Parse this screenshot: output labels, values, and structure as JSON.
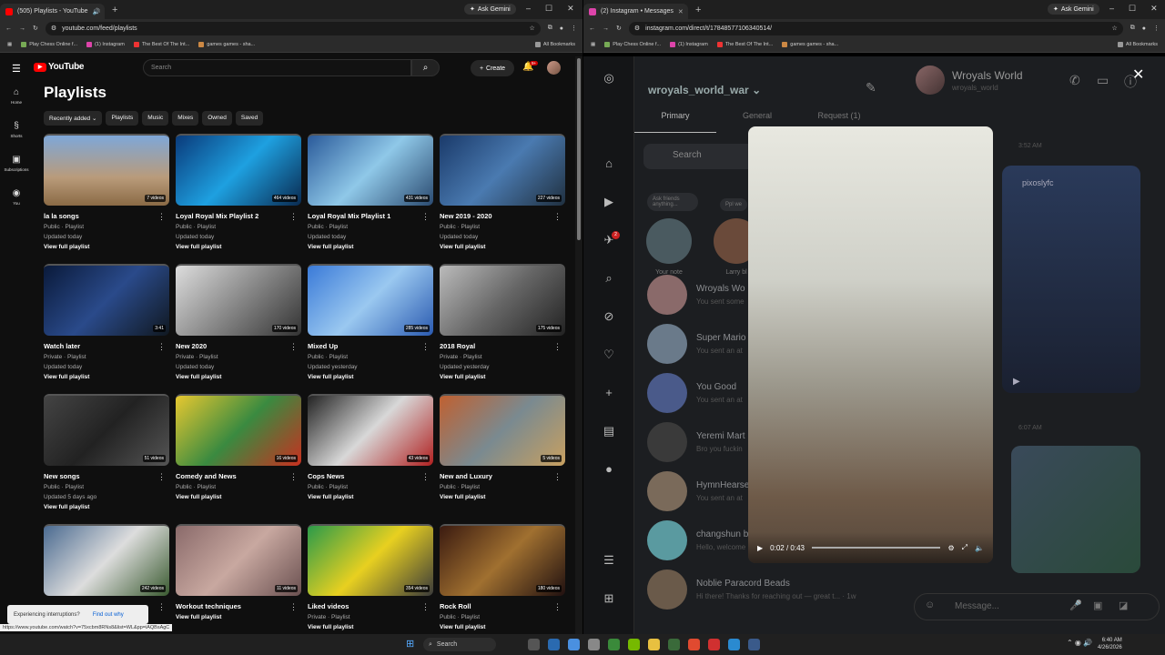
{
  "yt_window": {
    "tab_title": "(505) Playlists - YouTube",
    "ask_gemini": "Ask Gemini",
    "url": "youtube.com/feed/playlists",
    "bookmarks": [
      "Play Chess Online f...",
      "(1) Instagram",
      "The Best Of The Int...",
      "games games - sha..."
    ],
    "all_bookmarks": "All Bookmarks",
    "logo": "YouTube",
    "search_placeholder": "Search",
    "create": "Create",
    "notif_count": "9+",
    "side": [
      "Home",
      "Shorts",
      "Subscriptions",
      "You"
    ],
    "page_title": "Playlists",
    "chips": [
      "Recently added",
      "Playlists",
      "Music",
      "Mixes",
      "Owned",
      "Saved"
    ],
    "playlists": [
      {
        "name": "la la songs",
        "meta": [
          "Public · Playlist",
          "Updated today"
        ],
        "view": "View full playlist",
        "count": "7 videos",
        "bg": "linear-gradient(180deg,#7ea7d8 0%,#b99b7a 60%,#8a6a45 100%)"
      },
      {
        "name": "Loyal Royal Mix Playlist 2",
        "meta": [
          "Public · Playlist",
          "Updated today"
        ],
        "view": "View full playlist",
        "count": "464 videos",
        "bg": "linear-gradient(135deg,#0a3a7a,#1ea0e0,#0a2a50)"
      },
      {
        "name": "Loyal Royal Mix Playlist 1",
        "meta": [
          "Public · Playlist",
          "Updated today"
        ],
        "view": "View full playlist",
        "count": "431 videos",
        "bg": "linear-gradient(135deg,#2a5a9a,#8fc8e8,#2a4a70)"
      },
      {
        "name": "New 2019 - 2020",
        "meta": [
          "Public · Playlist",
          "Updated today"
        ],
        "view": "View full playlist",
        "count": "227 videos",
        "bg": "linear-gradient(135deg,#1a3a6a,#4a7ab0,#203040)"
      },
      {
        "name": "Watch later",
        "meta": [
          "Private · Playlist",
          "Updated today"
        ],
        "view": "View full playlist",
        "count": "3:41",
        "bg": "linear-gradient(135deg,#0a1a3a,#2a4a8a,#101820)"
      },
      {
        "name": "New 2020",
        "meta": [
          "Private · Playlist",
          "Updated today"
        ],
        "view": "View full playlist",
        "count": "170 videos",
        "bg": "linear-gradient(135deg,#ddd,#888,#333)"
      },
      {
        "name": "Mixed Up",
        "meta": [
          "Public · Playlist",
          "Updated yesterday"
        ],
        "view": "View full playlist",
        "count": "285 videos",
        "bg": "linear-gradient(135deg,#3a7ad8,#9ac8f0,#2a5ab0)"
      },
      {
        "name": "2018 Royal",
        "meta": [
          "Private · Playlist",
          "Updated yesterday"
        ],
        "view": "View full playlist",
        "count": "175 videos",
        "bg": "linear-gradient(135deg,#bbb,#666,#222)"
      },
      {
        "name": "New songs",
        "meta": [
          "Public · Playlist",
          "Updated 5 days ago"
        ],
        "view": "View full playlist",
        "count": "51 videos",
        "bg": "linear-gradient(135deg,#444,#222,#555)"
      },
      {
        "name": "Comedy and News",
        "meta": [
          "Public · Playlist"
        ],
        "view": "View full playlist",
        "count": "16 videos",
        "bg": "linear-gradient(135deg,#e8c830,#3a8a40,#c83020)"
      },
      {
        "name": "Cops News",
        "meta": [
          "Public · Playlist"
        ],
        "view": "View full playlist",
        "count": "43 videos",
        "bg": "linear-gradient(135deg,#222,#d8d8d8,#b02020)"
      },
      {
        "name": "New and Luxury",
        "meta": [
          "Public · Playlist"
        ],
        "view": "View full playlist",
        "count": "5 videos",
        "bg": "linear-gradient(135deg,#c06030,#7a8a90,#c8a060)"
      },
      {
        "name": "",
        "meta": [],
        "view": "",
        "count": "242 videos",
        "bg": "linear-gradient(135deg,#4a6a90,#ddd,#3a5a30)"
      },
      {
        "name": "Workout techniques",
        "meta": [],
        "view": "View full playlist",
        "count": "11 videos",
        "bg": "linear-gradient(135deg,#8a6a6a,#c8a8a0,#6a5050)"
      },
      {
        "name": "Liked videos",
        "meta": [
          "Private · Playlist"
        ],
        "view": "View full playlist",
        "count": "354 videos",
        "bg": "linear-gradient(135deg,#2a9a4a,#e8d020,#3a3a3a)"
      },
      {
        "name": "Rock Roll",
        "meta": [
          "Public · Playlist"
        ],
        "view": "View full playlist",
        "count": "180 videos",
        "bg": "linear-gradient(135deg,#3a1a10,#a07030,#201010)"
      }
    ],
    "toast": "Experiencing interruptions?",
    "toast_link": "Find out why",
    "status_url": "https://www.youtube.com/watch?v=75xcbm8RNs8&list=WL&pp=iAQBsAgC"
  },
  "ig_window": {
    "tab_title": "(2) Instagram • Messages",
    "ask_gemini": "Ask Gemini",
    "url": "instagram.com/direct/t/17848577106340514/",
    "bookmarks": [
      "Play Chess Online f...",
      "(1) Instagram",
      "The Best Of The Int...",
      "games games - sha..."
    ],
    "all_bookmarks": "All Bookmarks",
    "username": "wroyals_world_war",
    "tabs": [
      "Primary",
      "General",
      "Request (1)"
    ],
    "search": "Search",
    "rail_badge": "2",
    "note_bubble": "Ask friends anything...",
    "notes": [
      "Your note",
      "Larry bl"
    ],
    "note2_bubble": "Ppl we",
    "convs": [
      {
        "name": "Wroyals Wo",
        "msg": "You sent some"
      },
      {
        "name": "Super Mario",
        "msg": "You sent an at"
      },
      {
        "name": "You Good",
        "msg": "You sent an at"
      },
      {
        "name": "Yeremi Mart",
        "msg": "Bro you fuckin"
      },
      {
        "name": "HymnHearse",
        "msg": "You sent an at"
      },
      {
        "name": "changshun b",
        "msg": "Hello, welcome"
      },
      {
        "name": "Noblie Paracord Beads",
        "msg": "Hi there! Thanks for reaching out — great t... · 1w"
      }
    ],
    "chat_name": "Wroyals World",
    "chat_handle": "wroyals_world",
    "times": [
      "3:52 AM",
      "6:07 AM"
    ],
    "poster": "pixoslyfc",
    "video_time": "0:02 / 0:43",
    "message_placeholder": "Message..."
  },
  "taskbar": {
    "search": "Search",
    "time": "6:40 AM",
    "date": "4/26/2026"
  }
}
